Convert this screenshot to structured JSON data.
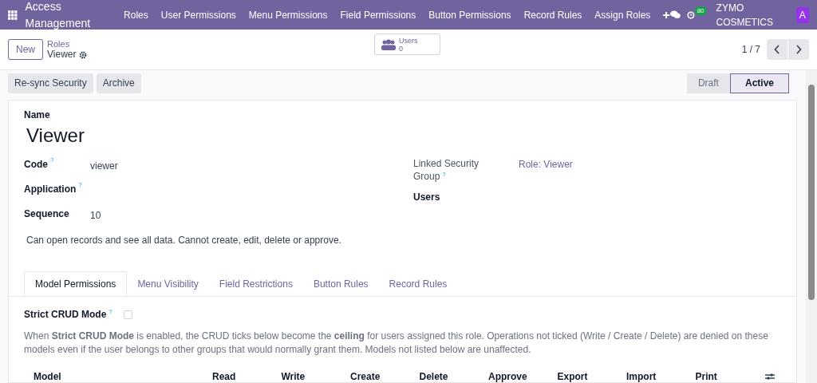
{
  "navbar": {
    "app_title": "Access Management",
    "menu": [
      "Roles",
      "User Permissions",
      "Menu Permissions",
      "Field Permissions",
      "Button Permissions",
      "Record Rules",
      "Assign Roles"
    ],
    "activity_badge": "80",
    "company": "ZYMO COSMETICS",
    "avatar": "A"
  },
  "control_panel": {
    "new_button": "New",
    "breadcrumb_parent": "Roles",
    "breadcrumb_current": "Viewer",
    "smart_button": {
      "label": "Users",
      "value": "0"
    },
    "pager": "1 / 7"
  },
  "actions": [
    "Re-sync Security",
    "Archive"
  ],
  "status_bar": [
    {
      "label": "Draft",
      "selected": false
    },
    {
      "label": "Active",
      "selected": true
    }
  ],
  "form": {
    "name_label": "Name",
    "name": "Viewer",
    "left_fields": [
      {
        "label": "Code",
        "help": "?",
        "value": "viewer"
      },
      {
        "label": "Application",
        "help": "?"
      },
      {
        "label": "Sequence",
        "value": "10"
      }
    ],
    "right_fields": [
      {
        "label": "Linked Security Group",
        "help": "?",
        "value": "Role: Viewer",
        "kind": "link"
      },
      {
        "label": "Users"
      }
    ],
    "description": "Can open records and see all data. Cannot create, edit, delete or approve."
  },
  "tabs": [
    {
      "label": "Model Permissions",
      "selected": true
    },
    {
      "label": "Menu Visibility",
      "selected": false
    },
    {
      "label": "Field Restrictions",
      "selected": false
    },
    {
      "label": "Button Rules",
      "selected": false
    },
    {
      "label": "Record Rules",
      "selected": false
    }
  ],
  "strict_mode": {
    "label": "Strict CRUD Mode",
    "help": "?",
    "checked": false
  },
  "note": "When **Strict CRUD Mode** is enabled, the CRUD ticks below become the **ceiling** for users assigned this role. Operations not ticked (Write / Create / Delete) are denied on these models even if the user belongs to other groups that would normally grant them. Models not listed below are unaffected.",
  "table": {
    "columns": [
      "Model",
      "Read",
      "Write",
      "Create",
      "Delete",
      "Approve",
      "Export",
      "Import",
      "Print"
    ]
  }
}
